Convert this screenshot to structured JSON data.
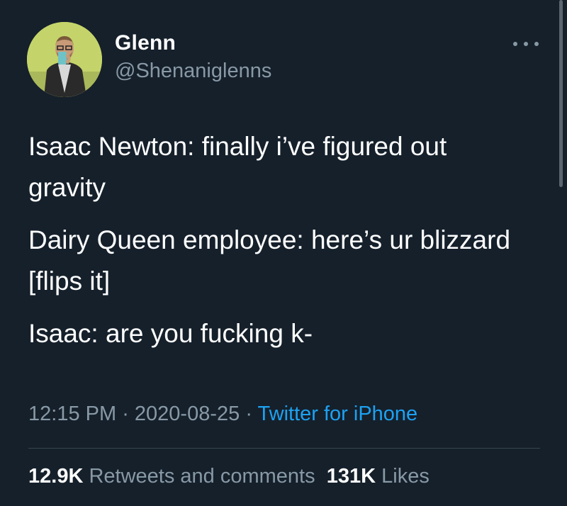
{
  "author": {
    "name": "Glenn",
    "handle": "@Shenaniglenns"
  },
  "tweet": {
    "lines": [
      "Isaac Newton: finally i’ve figured out gravity",
      "Dairy Queen employee: here’s ur blizzard [flips it]",
      "Isaac: are you fucking k-"
    ],
    "time": "12:15 PM",
    "date": "2020-08-25",
    "separator": " · ",
    "source": "Twitter for iPhone"
  },
  "stats": {
    "retweets_count": "12.9K",
    "retweets_label": "Retweets and comments",
    "likes_count": "131K",
    "likes_label": "Likes"
  },
  "icons": {
    "more": "more-horizontal-icon"
  },
  "colors": {
    "background": "#15202b",
    "secondary_text": "#8899a6",
    "link": "#1da1f2",
    "divider": "#38444d",
    "avatar_bg": "#c4d46a"
  }
}
